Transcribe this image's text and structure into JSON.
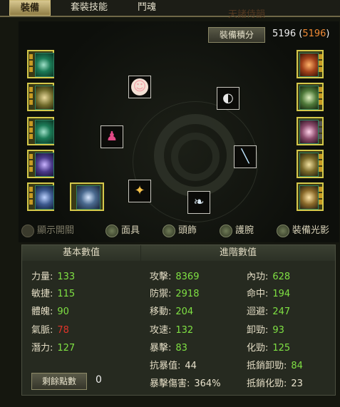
{
  "tabs": [
    "裝備",
    "套裝技能",
    "鬥魂"
  ],
  "ghost_text": "天諸侍韻",
  "score": {
    "label": "裝備積分",
    "value": "5196",
    "bonus": "5196"
  },
  "left_slots": 6,
  "right_slots": 5,
  "center_items": [
    {
      "name": "mask",
      "glyph": "☺"
    },
    {
      "name": "wrist",
      "glyph": "◐"
    },
    {
      "name": "robe",
      "glyph": "♟"
    },
    {
      "name": "sword",
      "glyph": "╲"
    },
    {
      "name": "charm",
      "glyph": "✦"
    },
    {
      "name": "feather",
      "glyph": "❧"
    }
  ],
  "toggles": [
    {
      "label": "顯示開關",
      "on": false
    },
    {
      "label": "面具",
      "on": true
    },
    {
      "label": "頭飾",
      "on": true
    },
    {
      "label": "護腕",
      "on": true
    },
    {
      "label": "裝備光影",
      "on": true
    }
  ],
  "stats": {
    "basic_title": "基本數值",
    "adv_title": "進階數值",
    "basic": [
      {
        "k": "力量:",
        "v": "133"
      },
      {
        "k": "敏捷:",
        "v": "115"
      },
      {
        "k": "體魄:",
        "v": "90"
      },
      {
        "k": "氣脈:",
        "v": "78"
      },
      {
        "k": "潛力:",
        "v": "127"
      }
    ],
    "adv_a": [
      {
        "k": "攻擊:",
        "v": "8369"
      },
      {
        "k": "防禦:",
        "v": "2918"
      },
      {
        "k": "移動:",
        "v": "204"
      },
      {
        "k": "攻速:",
        "v": "132"
      },
      {
        "k": "暴擊:",
        "v": "83"
      },
      {
        "k": "抗暴值:",
        "v": "44"
      },
      {
        "k": "暴擊傷害:",
        "v": "364%"
      }
    ],
    "adv_b": [
      {
        "k": "內功:",
        "v": "628"
      },
      {
        "k": "命中:",
        "v": "194"
      },
      {
        "k": "迴避:",
        "v": "247"
      },
      {
        "k": "卸勁:",
        "v": "93"
      },
      {
        "k": "化勁:",
        "v": "125"
      },
      {
        "k": "抵銷卸勁:",
        "v": "84"
      },
      {
        "k": "抵銷化勁:",
        "v": "23"
      }
    ],
    "points_label": "剩餘點數",
    "points_value": "0"
  }
}
